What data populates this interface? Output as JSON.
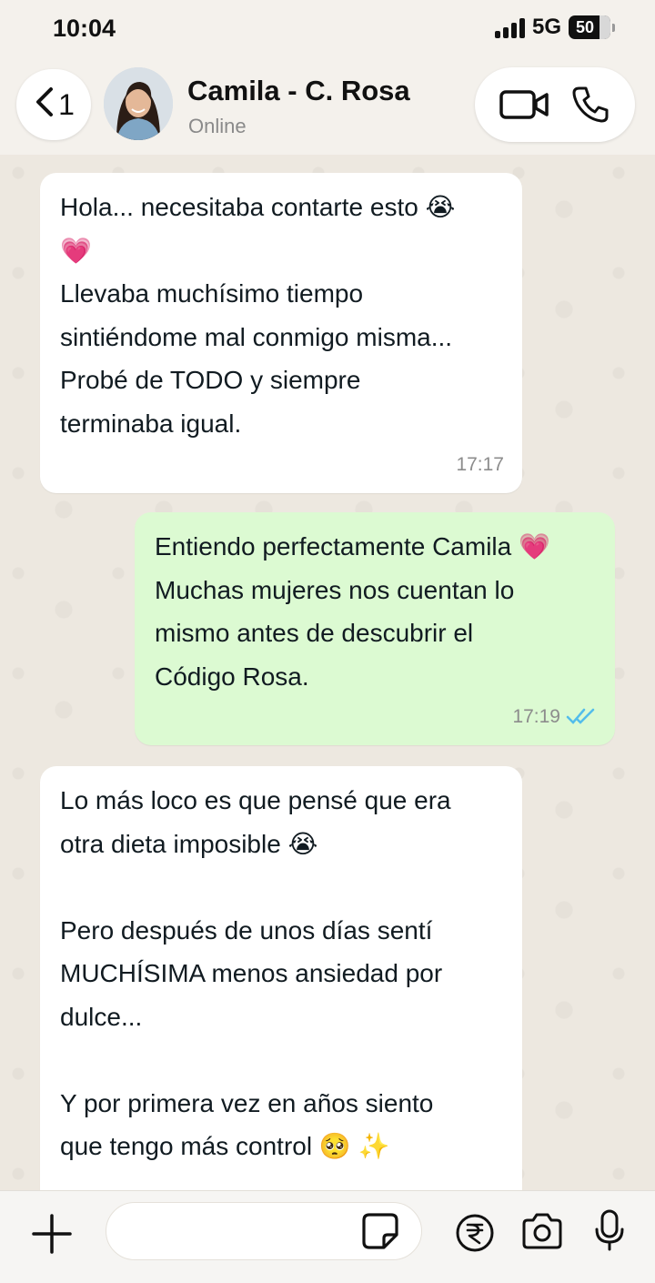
{
  "status_bar": {
    "time": "10:04",
    "network": "5G",
    "battery": "50"
  },
  "header": {
    "back_count": "1",
    "contact_name": "Camila - C. Rosa",
    "contact_status": "Online"
  },
  "messages": [
    {
      "direction": "incoming",
      "text": "Hola... necesitaba contarte esto 😭\n💗\nLlevaba muchísimo tiempo\nsintiéndome mal conmigo misma...\nProbé de TODO y siempre\nterminaba igual.",
      "time": "17:17"
    },
    {
      "direction": "outgoing",
      "text": "Entiendo perfectamente Camila 💗\nMuchas mujeres nos cuentan lo\nmismo antes de descubrir el\nCódigo Rosa.",
      "time": "17:19",
      "ticks": "✓✓"
    },
    {
      "direction": "incoming",
      "text": "Lo más loco es que pensé que era\notra dieta imposible 😭\n\nPero después de unos días sentí\nMUCHÍSIMA menos ansiedad por\ndulce...\n\nY por primera vez en años siento\nque tengo más control 🥺 ✨"
    }
  ],
  "composer": {
    "placeholder": "",
    "value": ""
  },
  "colors": {
    "outgoing_bubble": "#dcfad2",
    "incoming_bubble": "#ffffff",
    "read_ticks": "#53bdeb",
    "chat_background": "#efeae2"
  },
  "icons": [
    "back-chevron-icon",
    "video-call-icon",
    "phone-icon",
    "plus-icon",
    "sticker-icon",
    "rupee-icon",
    "camera-icon",
    "mic-icon"
  ]
}
